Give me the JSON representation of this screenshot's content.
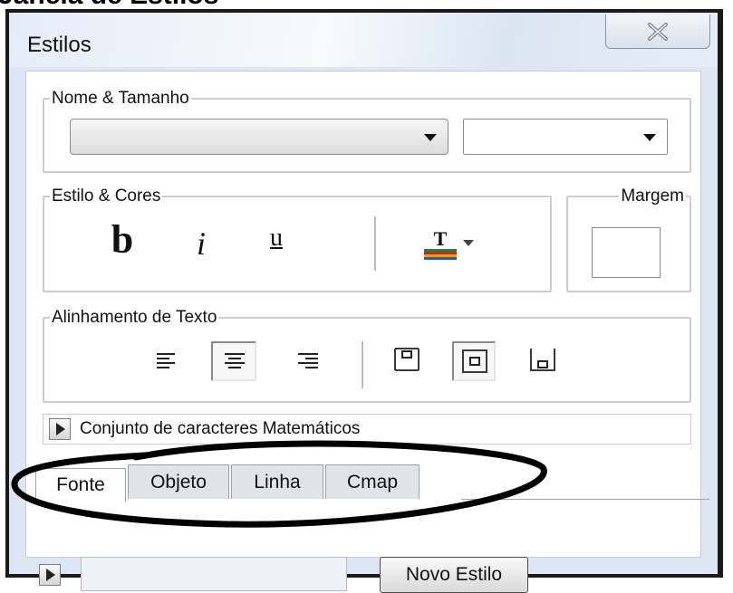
{
  "caption": "Janela de Estilos",
  "window": {
    "title": "Estilos"
  },
  "groups": {
    "name_size": "Nome & Tamanho",
    "style_colors": "Estilo & Cores",
    "margin": "Margem",
    "text_align": "Alinhamento de Texto"
  },
  "style_buttons": {
    "bold": "b",
    "italic": "i",
    "underline": "u",
    "text_color": "T"
  },
  "font_dropdown": {
    "value": ""
  },
  "size_dropdown": {
    "value": ""
  },
  "charset": {
    "label": "Conjunto de caracteres Matemáticos"
  },
  "tabs": [
    {
      "label": "Fonte",
      "active": true
    },
    {
      "label": "Objeto",
      "active": false
    },
    {
      "label": "Linha",
      "active": false
    },
    {
      "label": "Cmap",
      "active": false
    }
  ],
  "new_style_button": "Novo Estilo",
  "style_name_input": {
    "value": ""
  }
}
